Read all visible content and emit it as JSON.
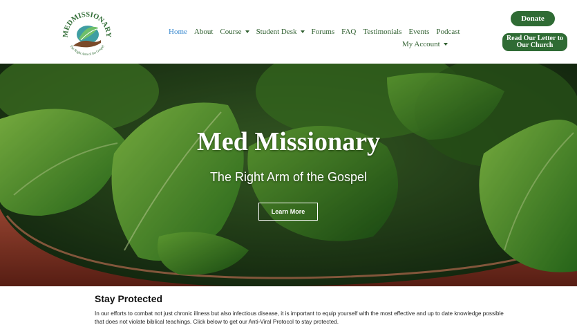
{
  "header": {
    "logo": {
      "brand_top": "MEDMISSIONARY",
      "brand_bottom": "The Right Arm of the Gospel"
    },
    "nav": [
      {
        "label": "Home",
        "active": true,
        "dropdown": false
      },
      {
        "label": "About",
        "active": false,
        "dropdown": false
      },
      {
        "label": "Course",
        "active": false,
        "dropdown": true
      },
      {
        "label": "Student Desk",
        "active": false,
        "dropdown": true
      },
      {
        "label": "Forums",
        "active": false,
        "dropdown": false
      },
      {
        "label": "FAQ",
        "active": false,
        "dropdown": false
      },
      {
        "label": "Testimonials",
        "active": false,
        "dropdown": false
      },
      {
        "label": "Events",
        "active": false,
        "dropdown": false
      },
      {
        "label": "Podcast",
        "active": false,
        "dropdown": false
      },
      {
        "label": "My Account",
        "active": false,
        "dropdown": true
      }
    ],
    "donate_label": "Donate",
    "letter_label": "Read Our Letter to Our Church"
  },
  "hero": {
    "title": "Med Missionary",
    "subtitle": "The Right Arm of the Gospel",
    "button_label": "Learn More"
  },
  "section": {
    "title": "Stay Protected",
    "text": "In our efforts to combat not just chronic illness but also infectious disease, it is important to equip yourself with the most effective and up to date knowledge possible that does not violate biblical teachings. Click below to get our Anti-Viral Protocol to stay protected."
  },
  "colors": {
    "brand_green": "#2f6b34",
    "nav_text": "#2f5f2f",
    "nav_active": "#3a8ad0"
  },
  "icons": {
    "dropdown": "chevron-down-icon",
    "logo": "leaf-hand-logo"
  }
}
